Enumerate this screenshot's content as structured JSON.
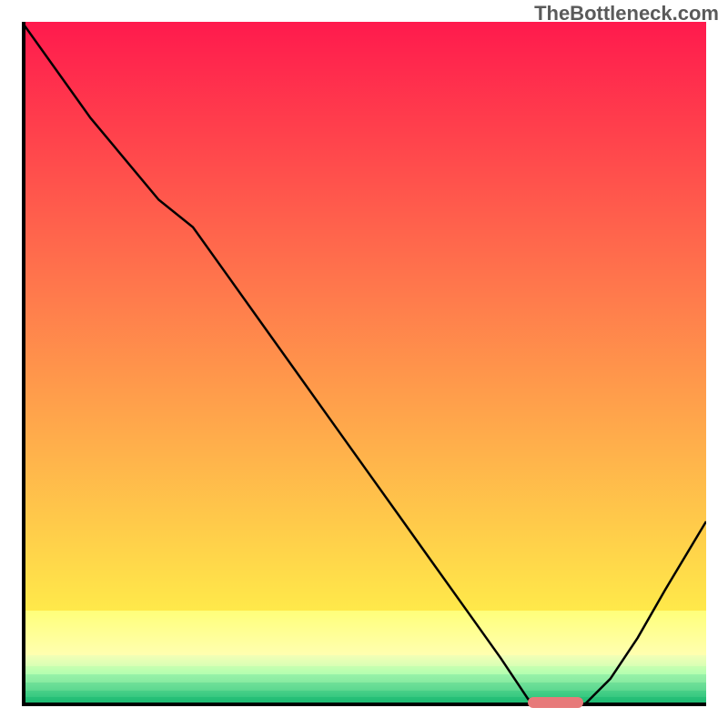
{
  "watermark": "TheBottleneck.com",
  "chart_data": {
    "type": "line",
    "title": "",
    "xlabel": "",
    "ylabel": "",
    "xlim": [
      0,
      100
    ],
    "ylim": [
      0,
      100
    ],
    "x": [
      0,
      5,
      10,
      15,
      20,
      25,
      30,
      35,
      40,
      45,
      50,
      55,
      60,
      65,
      70,
      74,
      78,
      82,
      86,
      90,
      94,
      100
    ],
    "values": [
      100,
      93,
      86,
      80,
      74,
      70,
      63,
      56,
      49,
      42,
      35,
      28,
      21,
      14,
      7,
      1,
      0,
      0,
      4,
      10,
      17,
      27
    ],
    "marker": {
      "x_start": 74,
      "x_end": 82,
      "y": 0
    },
    "gradient_bands": [
      {
        "top_pct": 0.0,
        "height_pct": 86.0,
        "color_top": "#ff1a4d",
        "color_bottom": "#ffe94a"
      },
      {
        "top_pct": 86.0,
        "height_pct": 6.5,
        "color_top": "#ffff7a",
        "color_bottom": "#ffffb0"
      },
      {
        "top_pct": 92.5,
        "height_pct": 1.6,
        "color_top": "#f2ffb5",
        "color_bottom": "#d8ffb5"
      },
      {
        "top_pct": 94.1,
        "height_pct": 1.3,
        "color_top": "#c8ffb0",
        "color_bottom": "#b0ffb0"
      },
      {
        "top_pct": 95.4,
        "height_pct": 1.2,
        "color_top": "#98f2a8",
        "color_bottom": "#85eaa0"
      },
      {
        "top_pct": 96.6,
        "height_pct": 1.1,
        "color_top": "#70e098",
        "color_bottom": "#5cd890"
      },
      {
        "top_pct": 97.7,
        "height_pct": 1.0,
        "color_top": "#48d088",
        "color_bottom": "#34c780"
      },
      {
        "top_pct": 98.7,
        "height_pct": 1.3,
        "color_top": "#28c078",
        "color_bottom": "#18b870"
      }
    ]
  }
}
